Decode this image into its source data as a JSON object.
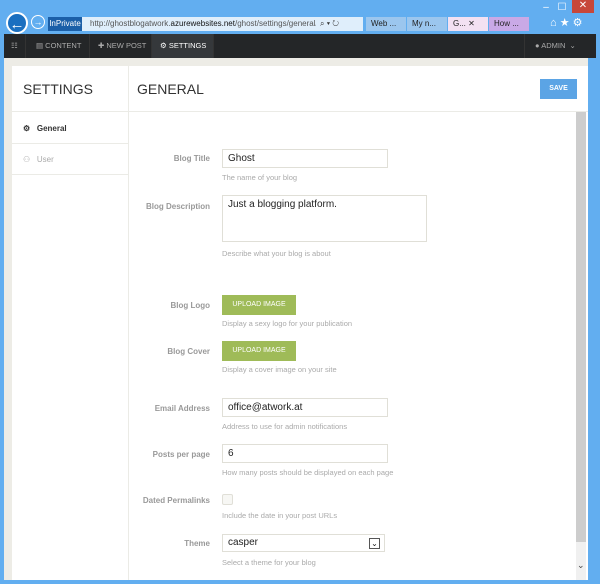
{
  "browser": {
    "inprivate": "InPrivate",
    "url_prefix": "http://ghostblogatwork.",
    "url_domain": "azurewebsites.net",
    "url_path": "/ghost/settings/general/",
    "tabs": [
      "Web ...",
      "My n...",
      "G...",
      "How ..."
    ]
  },
  "nav": {
    "content": "CONTENT",
    "new_post": "NEW POST",
    "settings": "SETTINGS",
    "user": "ADMIN"
  },
  "sidebar": {
    "title": "SETTINGS",
    "items": [
      {
        "label": "General"
      },
      {
        "label": "User"
      }
    ]
  },
  "main": {
    "title": "GENERAL",
    "save": "SAVE"
  },
  "form": {
    "blog_title": {
      "label": "Blog Title",
      "value": "Ghost",
      "help": "The name of your blog"
    },
    "blog_description": {
      "label": "Blog Description",
      "value": "Just a blogging platform.",
      "help": "Describe what your blog is about"
    },
    "blog_logo": {
      "label": "Blog Logo",
      "button": "UPLOAD IMAGE",
      "help": "Display a sexy logo for your publication"
    },
    "blog_cover": {
      "label": "Blog Cover",
      "button": "UPLOAD IMAGE",
      "help": "Display a cover image on your site"
    },
    "email": {
      "label": "Email Address",
      "value": "office@atwork.at",
      "help": "Address to use for admin notifications"
    },
    "posts_per_page": {
      "label": "Posts per page",
      "value": "6",
      "help": "How many posts should be displayed on each page"
    },
    "dated_permalinks": {
      "label": "Dated Permalinks",
      "checked": false,
      "help": "Include the date in your post URLs"
    },
    "theme": {
      "label": "Theme",
      "value": "casper",
      "help": "Select a theme for your blog"
    }
  }
}
